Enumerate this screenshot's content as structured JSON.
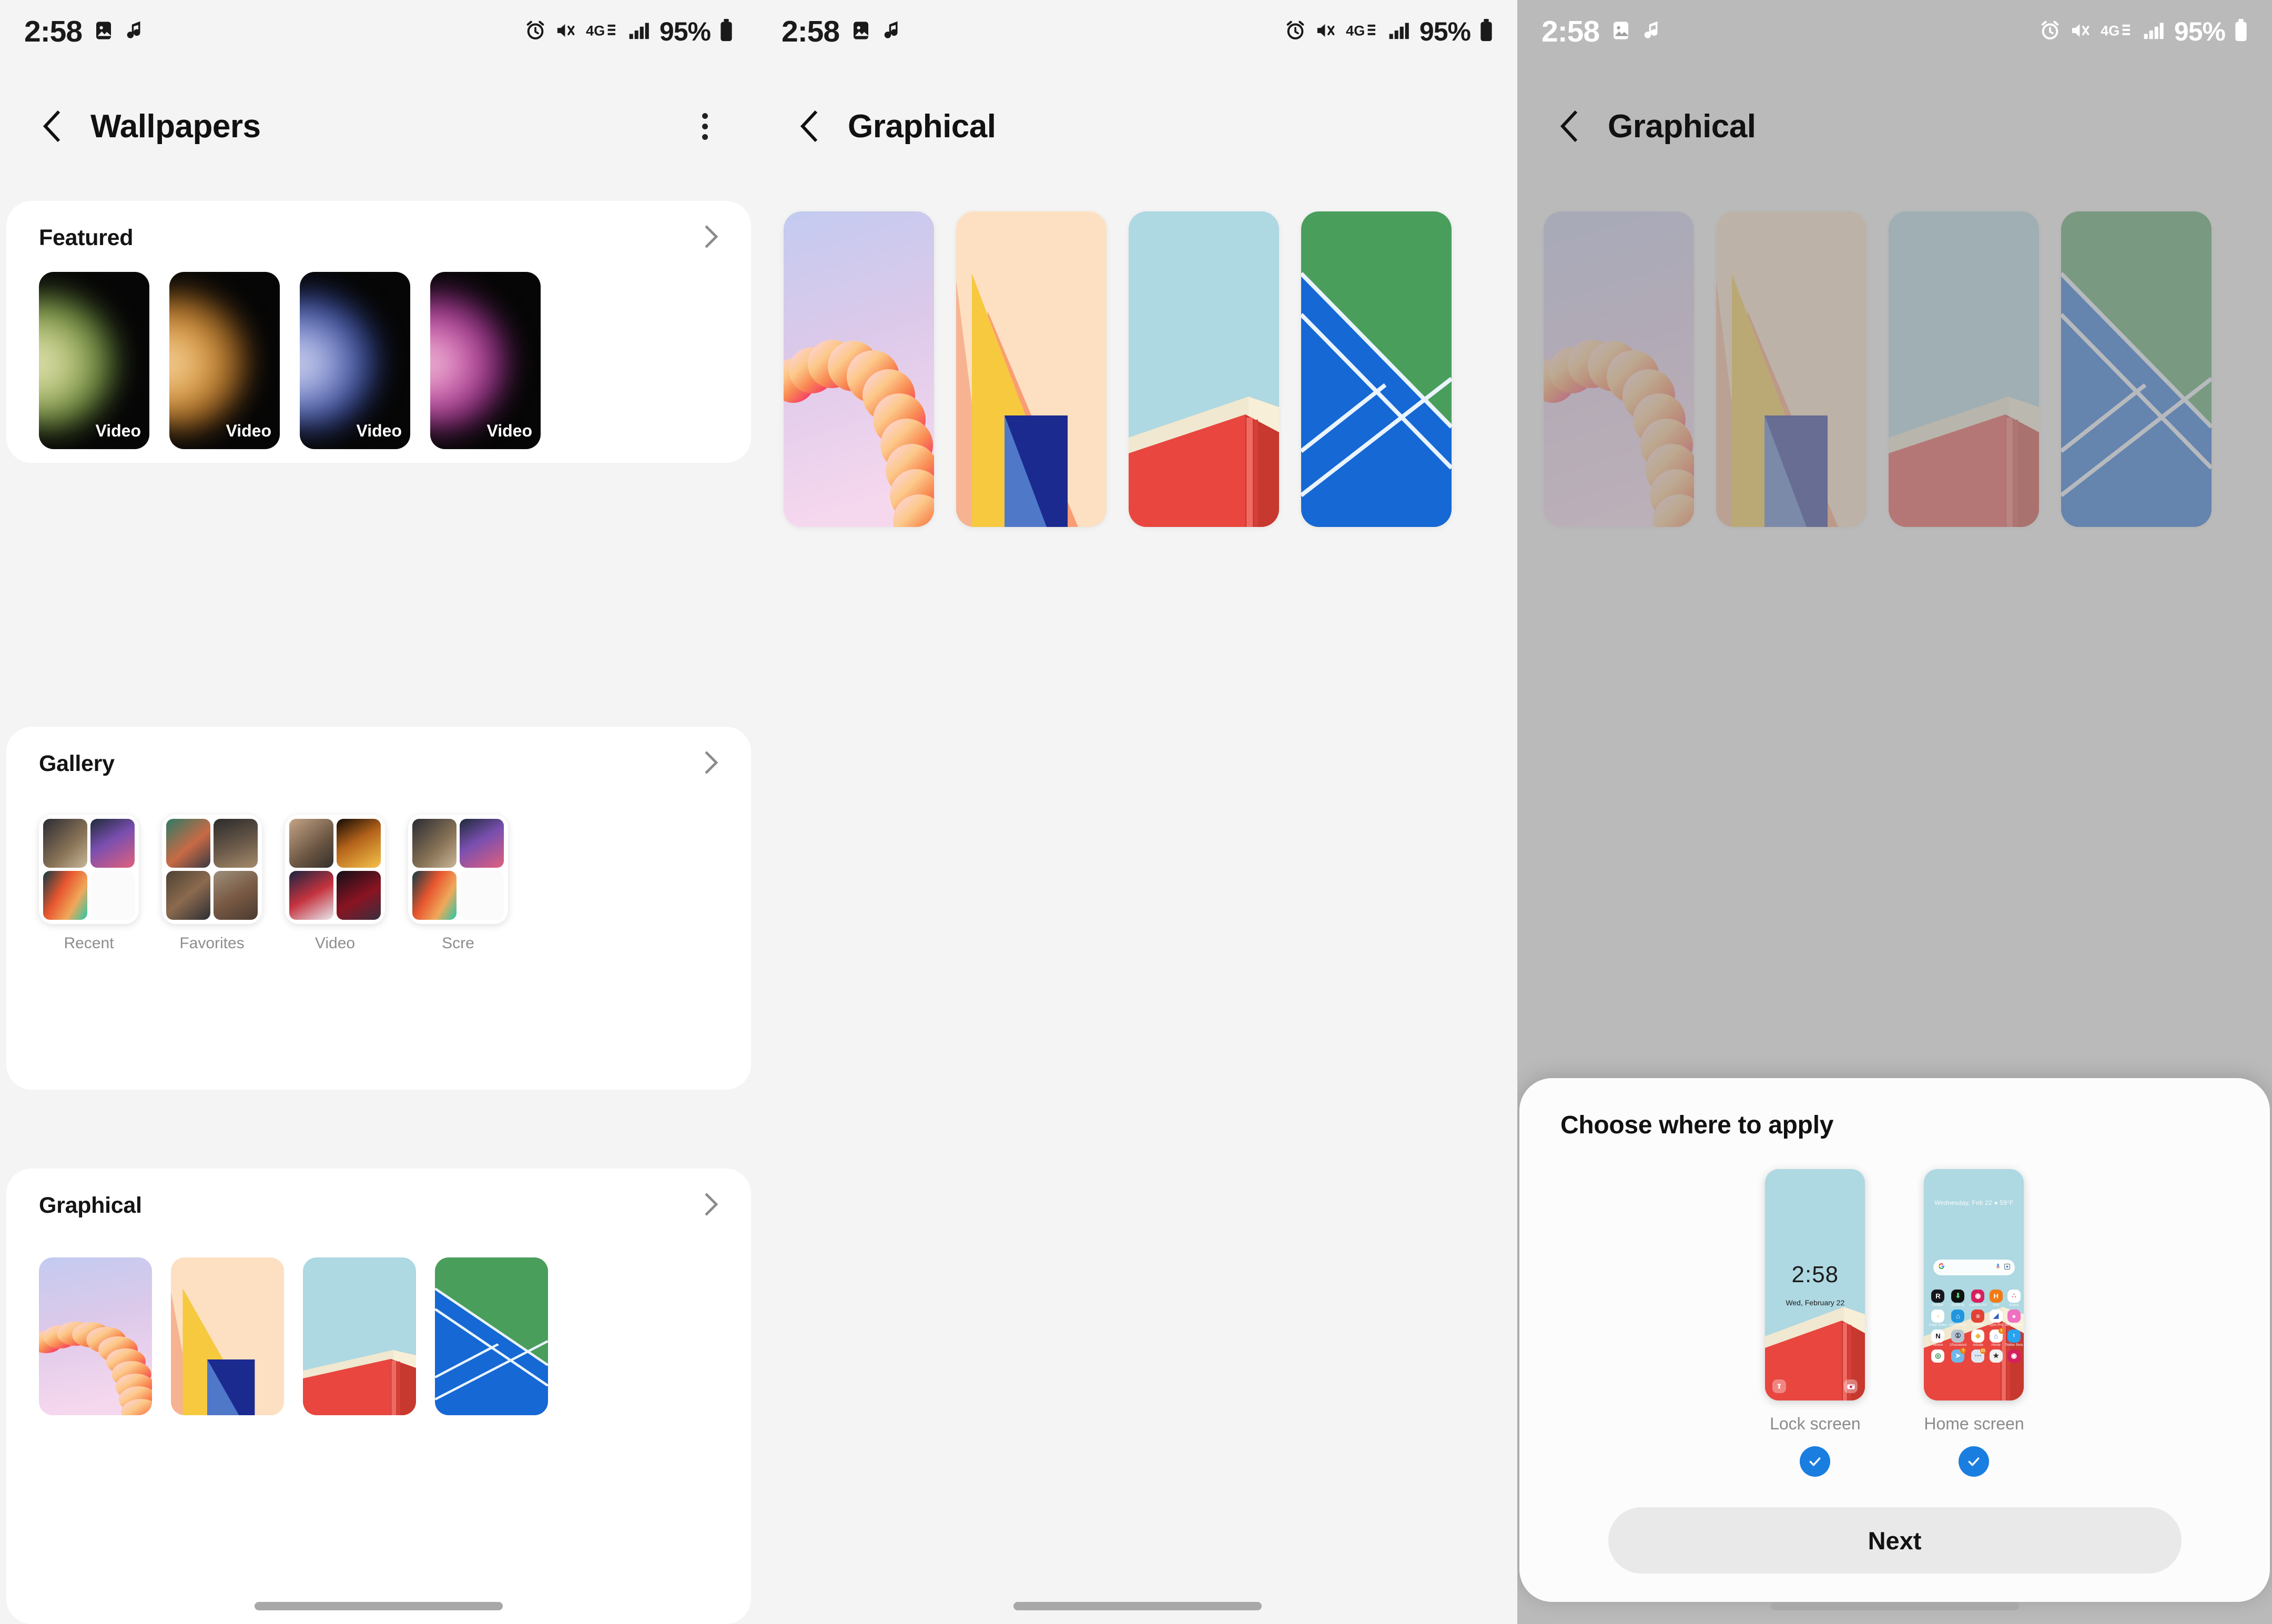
{
  "statusbar": {
    "time": "2:58",
    "battery": "95%",
    "icons": [
      "gallery-icon",
      "music-note-icon",
      "alarm-icon",
      "mute-vibrate-icon",
      "4g-lte-icon",
      "signal-bars-icon",
      "battery-icon"
    ]
  },
  "panel1": {
    "title": "Wallpapers",
    "back_icon": "back-chevron-icon",
    "menu_icon": "overflow-menu-icon",
    "sections": [
      {
        "title": "Featured",
        "chevron": "chevron-right-icon",
        "tiles": [
          {
            "label": "Video",
            "art": "orb-g"
          },
          {
            "label": "Video",
            "art": "orb-o"
          },
          {
            "label": "Video",
            "art": "orb-b"
          },
          {
            "label": "Video",
            "art": "orb-p"
          }
        ]
      },
      {
        "title": "Gallery",
        "chevron": "chevron-right-icon",
        "albums": [
          {
            "label": "Recent"
          },
          {
            "label": "Favorites"
          },
          {
            "label": "Video"
          },
          {
            "label": "Scre"
          }
        ]
      },
      {
        "title": "Graphical",
        "chevron": "chevron-right-icon",
        "tiles": [
          {
            "art": "clouds"
          },
          {
            "art": "yellow"
          },
          {
            "art": "blue"
          },
          {
            "art": "green"
          }
        ]
      }
    ]
  },
  "panel2": {
    "title": "Graphical",
    "back_icon": "back-chevron-icon",
    "tiles": [
      {
        "art": "clouds"
      },
      {
        "art": "yellow"
      },
      {
        "art": "blue"
      },
      {
        "art": "green"
      }
    ]
  },
  "panel3": {
    "title": "Graphical",
    "back_icon": "back-chevron-icon",
    "tiles": [
      {
        "art": "clouds"
      },
      {
        "art": "yellow"
      },
      {
        "art": "blue"
      },
      {
        "art": "green"
      }
    ],
    "dialog": {
      "title": "Choose where to apply",
      "next_label": "Next",
      "options": [
        {
          "label": "Lock screen",
          "checked": true,
          "check_icon": "check-circle-icon"
        },
        {
          "label": "Home screen",
          "checked": true,
          "check_icon": "check-circle-icon"
        }
      ],
      "lock_preview": {
        "time": "2:58",
        "date": "Wed, February 22",
        "left_icon": "flashlight-icon",
        "right_icon": "camera-icon"
      },
      "home_preview": {
        "weather": "Wednesday, Feb 22   ●  59°F",
        "search_icons": [
          "google-g-icon",
          "microphone-icon",
          "lens-camera-icon"
        ],
        "apps": [
          {
            "name": "Reader",
            "glyph": "R",
            "bg": "#16171d",
            "fg": "#ffffff",
            "badge": ""
          },
          {
            "name": "Droid-ify",
            "glyph": "⬇",
            "bg": "#111111",
            "fg": "#4ee07f",
            "badge": ""
          },
          {
            "name": "Camera RAW",
            "glyph": "◉",
            "bg": "#d6205e",
            "fg": "#ffffff",
            "badge": ""
          },
          {
            "name": "Hub",
            "glyph": "H",
            "bg": "#f07a16",
            "fg": "#ffffff",
            "badge": ""
          },
          {
            "name": "Asana",
            "glyph": "∴",
            "bg": "#ffffff",
            "fg": "#e5485e",
            "badge": ""
          },
          {
            "name": "Keep Notes",
            "glyph": "▫",
            "bg": "#ffffff",
            "fg": "#f5bb16",
            "badge": ""
          },
          {
            "name": "Home Assistant",
            "glyph": "⌂",
            "bg": "#2196de",
            "fg": "#ffffff",
            "badge": ""
          },
          {
            "name": "Todoist",
            "glyph": "≡",
            "bg": "#e04236",
            "fg": "#ffffff",
            "badge": ""
          },
          {
            "name": "Sync Pro",
            "glyph": "◢",
            "bg": "#ffffff",
            "fg": "#2f5fbf",
            "badge": ""
          },
          {
            "name": "Megalodon",
            "glyph": "●",
            "bg": "#f06fc0",
            "fg": "#ffffff",
            "badge": ""
          },
          {
            "name": "Notion",
            "glyph": "N",
            "bg": "#ffffff",
            "fg": "#111111",
            "badge": ""
          },
          {
            "name": "1Password",
            "glyph": "①",
            "bg": "#b9c4cf",
            "fg": "#1f3b63",
            "badge": ""
          },
          {
            "name": "Artside",
            "glyph": "◆",
            "bg": "#ffffff",
            "fg": "#e8b93b",
            "badge": ""
          },
          {
            "name": "Home",
            "glyph": "⌂",
            "bg": "#ffffff",
            "fg": "#3c78d8",
            "badge": "3"
          },
          {
            "name": "Twitter Beta",
            "glyph": "ᵗ",
            "bg": "#29a3ef",
            "fg": "#ffffff",
            "badge": ""
          },
          {
            "name": "",
            "glyph": "◎",
            "bg": "#ffffff",
            "fg": "#2f8a46",
            "badge": ""
          },
          {
            "name": "",
            "glyph": "➤",
            "bg": "#6fb8e8",
            "fg": "#ffffff",
            "badge": "7"
          },
          {
            "name": "",
            "glyph": "⋯",
            "bg": "#dde7f2",
            "fg": "#4a6a8a",
            "badge": "21"
          },
          {
            "name": "",
            "glyph": "★",
            "bg": "#f2f2f2",
            "fg": "#2a2a2a",
            "badge": ""
          },
          {
            "name": "",
            "glyph": "◉",
            "bg": "#d6205e",
            "fg": "#ffffff",
            "badge": ""
          }
        ]
      }
    }
  },
  "colors": {
    "accent": "#1a7ee0",
    "card_bg": "#ffffff",
    "page_bg": "#f4f4f4",
    "dim_overlay": "#969696"
  }
}
